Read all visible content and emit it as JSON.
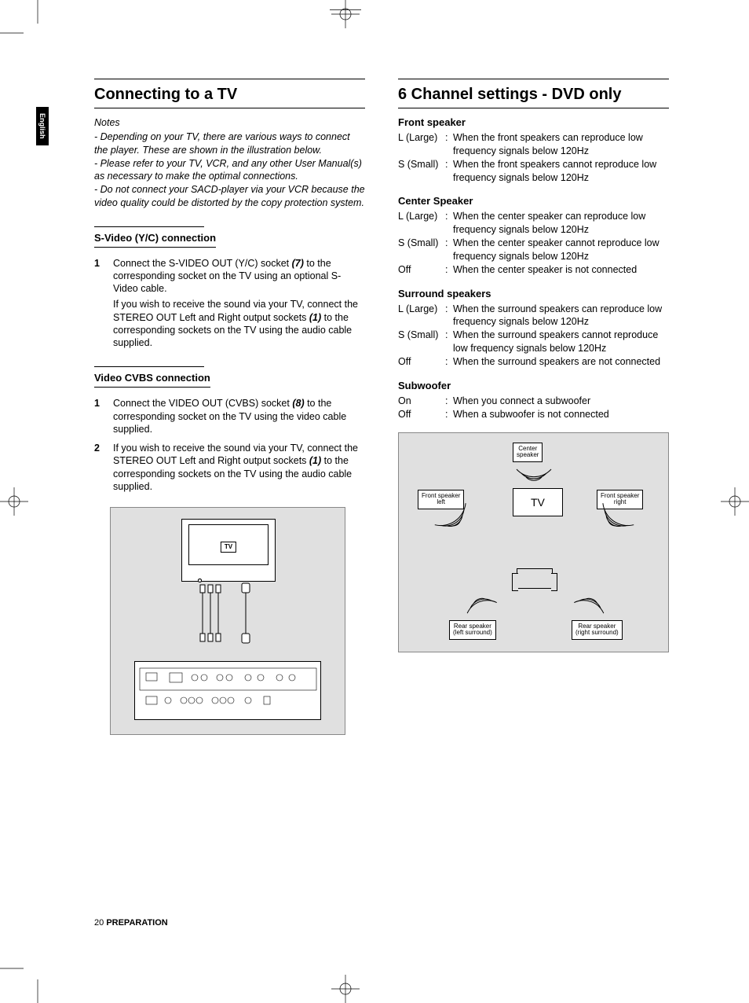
{
  "language_tab": "English",
  "left": {
    "heading": "Connecting to a TV",
    "notes_label": "Notes",
    "notes": [
      "- Depending on your TV, there are various ways to connect the player. These are shown in the illustration below.",
      "- Please refer to your TV, VCR, and any other User Manual(s) as necessary to make the optimal connections.",
      "- Do not connect your SACD-player via your VCR because the video quality could be distorted by the copy protection system."
    ],
    "svideo": {
      "title": "S-Video (Y/C) connection",
      "steps": [
        {
          "num": "1",
          "parts": [
            {
              "t": "plain",
              "v": "Connect the S-VIDEO OUT (Y/C) socket "
            },
            {
              "t": "bi",
              "v": "(7)"
            },
            {
              "t": "plain",
              "v": " to the corresponding socket on the TV using an optional S-Video cable."
            }
          ],
          "para2_parts": [
            {
              "t": "plain",
              "v": "If you wish to receive the sound via your TV, connect the STEREO OUT Left and Right output sockets "
            },
            {
              "t": "bi",
              "v": "(1)"
            },
            {
              "t": "plain",
              "v": " to the corresponding sockets on the TV using the audio cable supplied."
            }
          ]
        }
      ]
    },
    "cvbs": {
      "title": "Video CVBS connection",
      "steps": [
        {
          "num": "1",
          "parts": [
            {
              "t": "plain",
              "v": "Connect the VIDEO OUT (CVBS) socket "
            },
            {
              "t": "bi",
              "v": "(8)"
            },
            {
              "t": "plain",
              "v": " to the corresponding socket on the TV using the video cable supplied."
            }
          ]
        },
        {
          "num": "2",
          "parts": [
            {
              "t": "plain",
              "v": "If you wish to receive the sound via your TV, connect the STEREO OUT Left and Right output sockets "
            },
            {
              "t": "bi",
              "v": "(1)"
            },
            {
              "t": "plain",
              "v": " to the corresponding sockets on the TV using the audio cable supplied."
            }
          ]
        }
      ]
    },
    "diagram_tv_label": "TV"
  },
  "right": {
    "heading": "6 Channel settings - DVD only",
    "blocks": [
      {
        "title": "Front speaker",
        "rows": [
          {
            "label": "L (Large)",
            "desc": "When the front speakers can reproduce low frequency signals below 120Hz"
          },
          {
            "label": "S (Small)",
            "desc": "When the front speakers cannot reproduce low frequency signals below 120Hz"
          }
        ]
      },
      {
        "title": "Center Speaker",
        "rows": [
          {
            "label": "L (Large)",
            "desc": "When the center  speaker can reproduce low frequency signals below 120Hz"
          },
          {
            "label": "S (Small)",
            "desc": "When the center  speaker cannot reproduce low frequency signals below 120Hz"
          },
          {
            "label": "Off",
            "desc": "When the center speaker is not connected"
          }
        ]
      },
      {
        "title": "Surround speakers",
        "rows": [
          {
            "label": "L (Large)",
            "desc": "When the surround speakers can reproduce low frequency signals below 120Hz"
          },
          {
            "label": "S (Small)",
            "desc": "When the surround speakers cannot reproduce low frequency signals below 120Hz"
          },
          {
            "label": "Off",
            "desc": "When the surround speakers are not connected"
          }
        ]
      },
      {
        "title": "Subwoofer",
        "rows": [
          {
            "label": "On",
            "desc": "When you connect a subwoofer"
          },
          {
            "label": "Off",
            "desc": "When a subwoofer is not connected"
          }
        ]
      }
    ],
    "speaker_labels": {
      "center": "Center\nspeaker",
      "fl": "Front speaker\nleft",
      "fr": "Front speaker\nright",
      "rl": "Rear speaker\n(left surround)",
      "rr": "Rear speaker\n(right surround)",
      "tv": "TV"
    }
  },
  "footer": {
    "page": "20",
    "section": "PREPARATION"
  }
}
